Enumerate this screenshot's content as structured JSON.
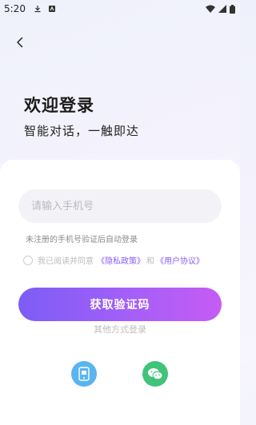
{
  "status_bar": {
    "time": "5:20"
  },
  "header": {
    "title": "欢迎登录",
    "subtitle": "智能对话，一触即达"
  },
  "form": {
    "phone_placeholder": "请输入手机号",
    "phone_value": "",
    "hint": "未注册的手机号验证后自动登录",
    "agree_prefix": "我已阅读并同意",
    "privacy_link": "《隐私政策》",
    "and_text": "和",
    "user_agreement_link": "《用户协议》",
    "agreed": false,
    "submit_label": "获取验证码"
  },
  "other_login": {
    "label": "其他方式登录",
    "methods": [
      "phone-login-icon",
      "wechat-icon"
    ]
  },
  "colors": {
    "accent_start": "#7c5df6",
    "accent_end": "#c65bf4",
    "link": "#8b5cf6",
    "phone_method": "#5ab5ef",
    "wechat": "#3fc47a"
  }
}
